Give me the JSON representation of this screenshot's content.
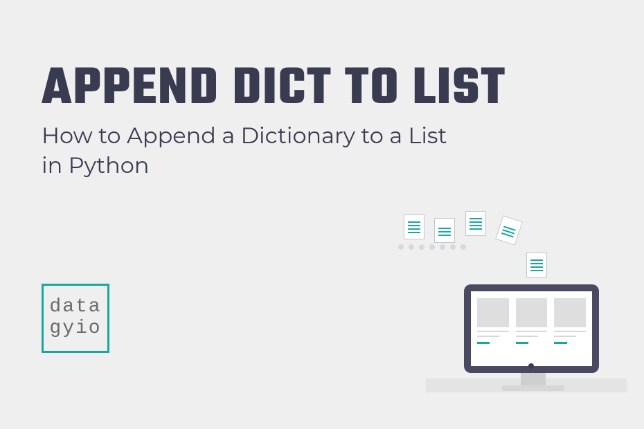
{
  "title": "APPEND DICT TO LIST",
  "subtitle": "How to Append a Dictionary to a List in Python",
  "logo": {
    "line1": "data",
    "line2": "gyio"
  },
  "colors": {
    "accent": "#18a89f",
    "heading": "#393b50",
    "background": "#efefef"
  }
}
